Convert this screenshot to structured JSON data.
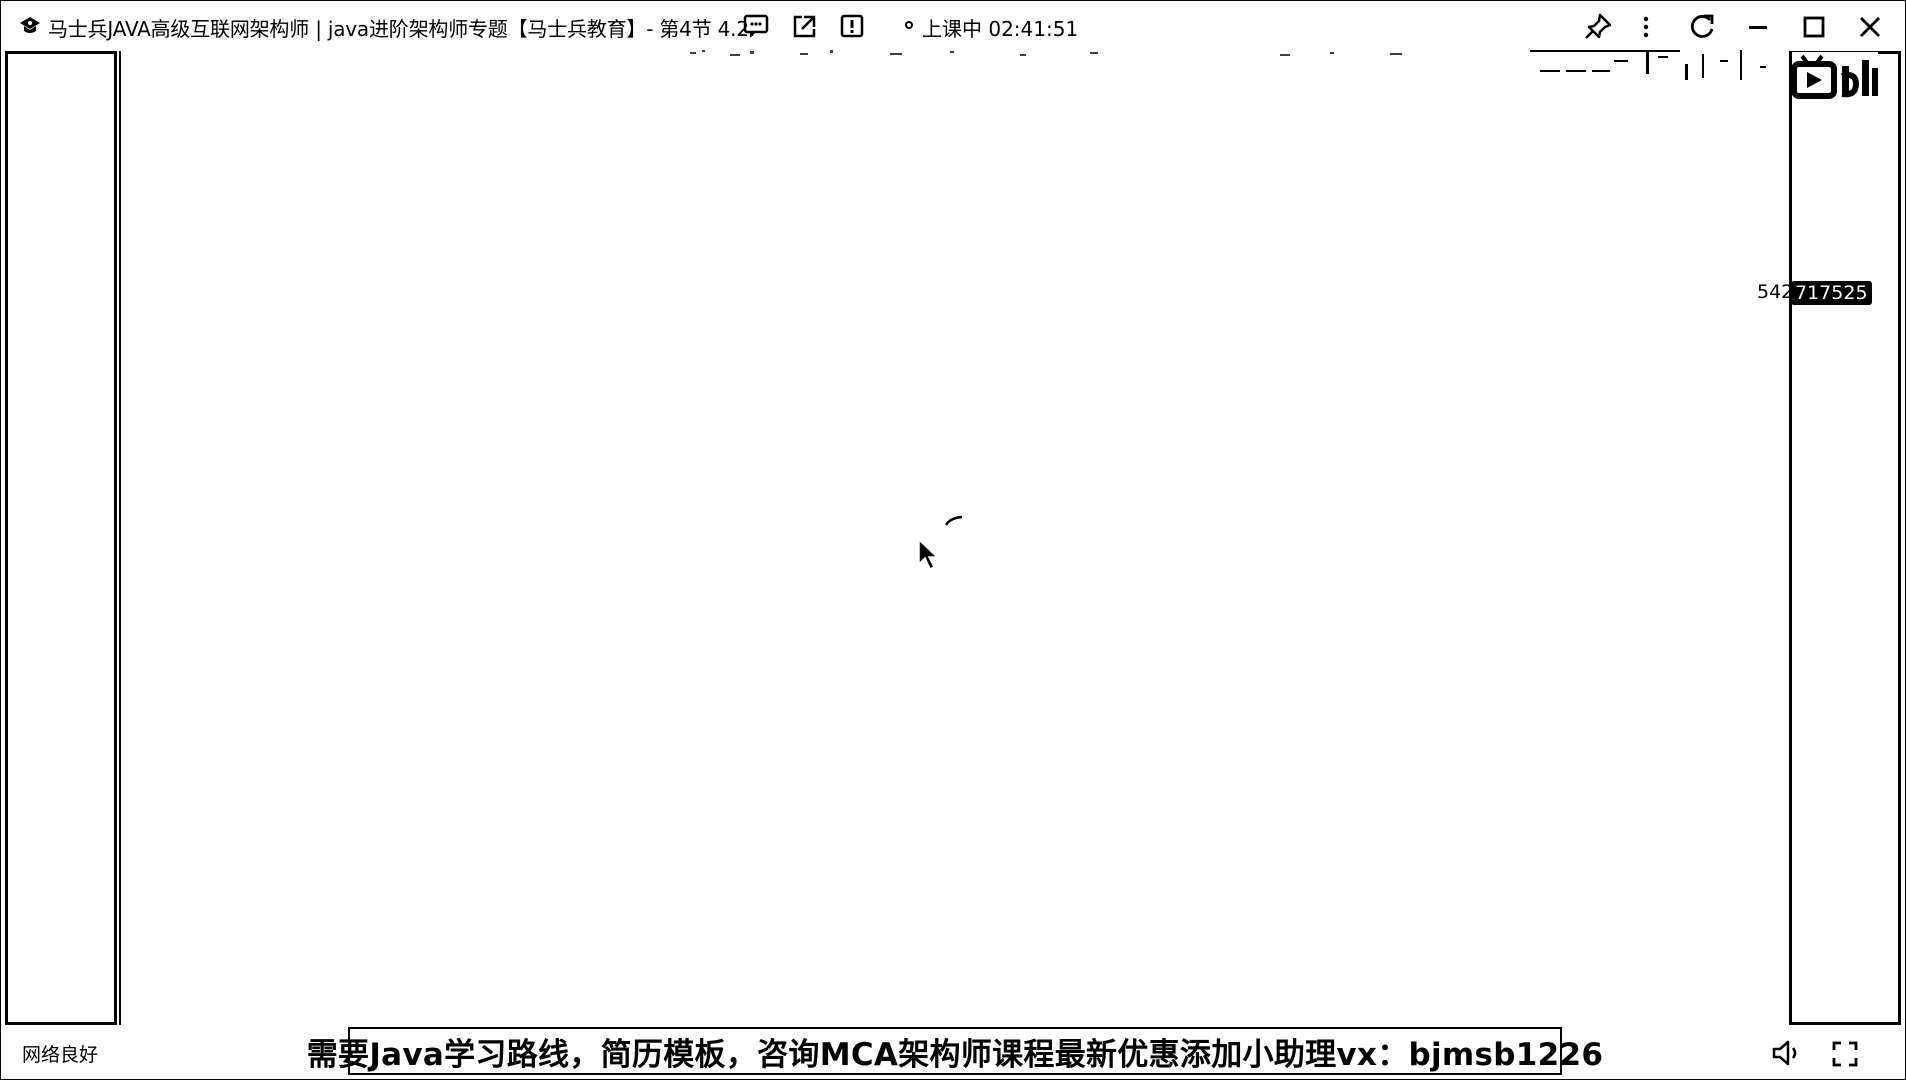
{
  "window": {
    "title": "马士兵JAVA高级互联网架构师 | java进阶架构师专题【马士兵教育】- 第4节 4.2.",
    "class_status": "上课中 02:41:51",
    "icons": {
      "app": "logo-icon",
      "chat": "chat-icon",
      "share": "share-icon",
      "report": "report-icon",
      "pin": "pin-icon",
      "more": "more-icon",
      "refresh": "refresh-icon",
      "minimize": "minimize-icon",
      "maximize": "maximize-icon",
      "close": "close-icon"
    }
  },
  "watermark": {
    "uid_plain": "542",
    "uid_boxed": "717525",
    "logo_icon": "bilibili-logo"
  },
  "footer": {
    "network_status": "网络良好",
    "banner_text": "需要Java学习路线，简历模板，咨询MCA架构师课程最新优惠添加小助理vx：bjmsb1226",
    "volume_icon": "volume-icon",
    "fullscreen_icon": "fullscreen-icon"
  }
}
